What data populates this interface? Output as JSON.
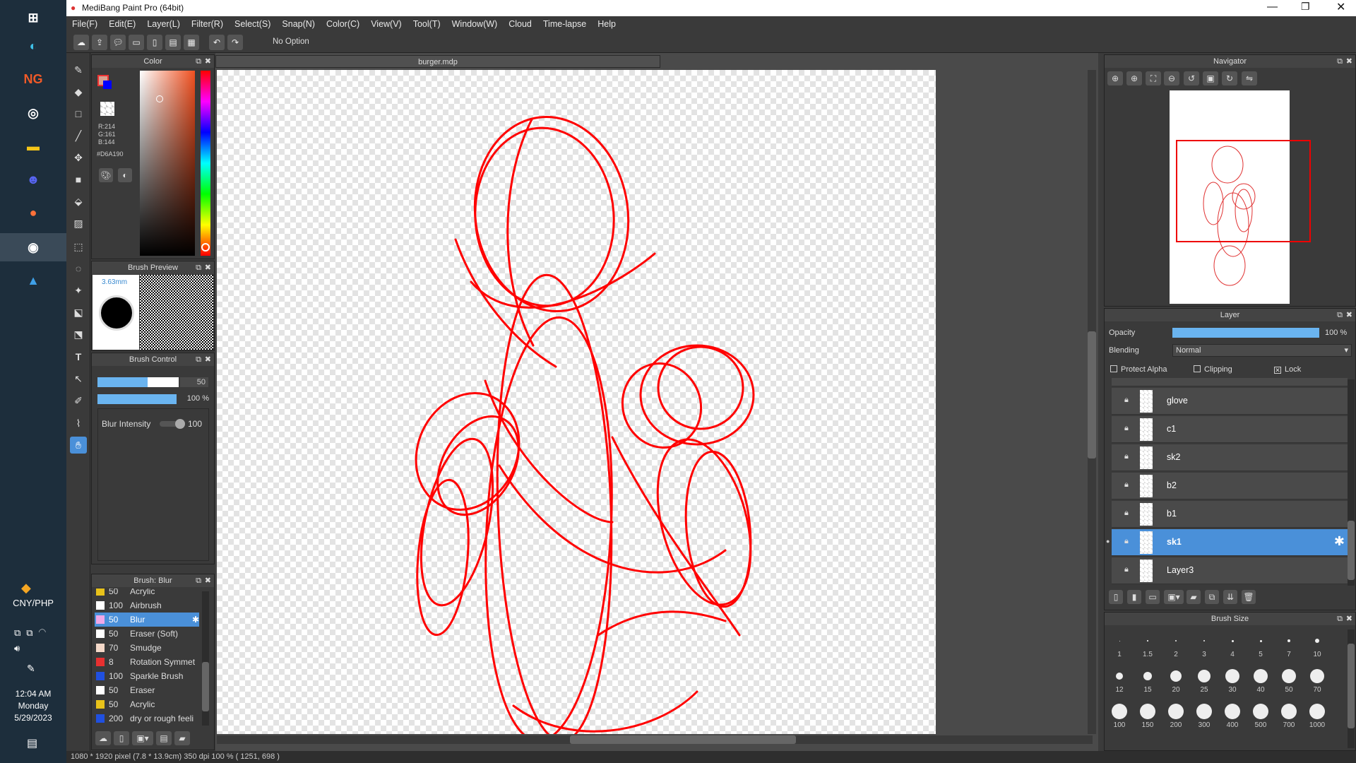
{
  "window": {
    "title": "MediBang Paint Pro (64bit)"
  },
  "menu": [
    "File(F)",
    "Edit(E)",
    "Layer(L)",
    "Filter(R)",
    "Select(S)",
    "Snap(N)",
    "Color(C)",
    "View(V)",
    "Tool(T)",
    "Window(W)",
    "Cloud",
    "Time-lapse",
    "Help"
  ],
  "toolbar": {
    "snap_label": "No Option"
  },
  "document": {
    "tab": "burger.mdp"
  },
  "color_panel": {
    "title": "Color",
    "r": "R:214",
    "g": "G:161",
    "b": "B:144",
    "hex": "#D6A190"
  },
  "brush_preview": {
    "title": "Brush Preview",
    "size": "3.63mm"
  },
  "brush_control": {
    "title": "Brush Control",
    "size_value": "50",
    "opacity_value": "100 %",
    "blur_label": "Blur Intensity",
    "blur_value": "100"
  },
  "brush_list": {
    "title": "Brush: Blur",
    "items": [
      {
        "size": "50",
        "name": "Acrylic",
        "color": "#e8c21a"
      },
      {
        "size": "100",
        "name": "Airbrush",
        "color": "#ffffff"
      },
      {
        "size": "50",
        "name": "Blur",
        "color": "#f0a8e8",
        "selected": true
      },
      {
        "size": "50",
        "name": "Eraser (Soft)",
        "color": "#ffffff"
      },
      {
        "size": "70",
        "name": "Smudge",
        "color": "#f4d8c8"
      },
      {
        "size": "8",
        "name": "Rotation Symmet",
        "color": "#e83030"
      },
      {
        "size": "100",
        "name": "Sparkle Brush",
        "color": "#2050e0"
      },
      {
        "size": "50",
        "name": "Eraser",
        "color": "#ffffff"
      },
      {
        "size": "50",
        "name": "Acrylic",
        "color": "#e8c21a"
      },
      {
        "size": "200",
        "name": "dry or rough feeli",
        "color": "#2050e0"
      }
    ]
  },
  "navigator": {
    "title": "Navigator"
  },
  "layer_panel": {
    "title": "Layer",
    "opacity_label": "Opacity",
    "opacity_value": "100 %",
    "opacity_fraction": 1.0,
    "blending_label": "Blending",
    "blending_value": "Normal",
    "protect_alpha": "Protect Alpha",
    "clipping": "Clipping",
    "lock": "Lock",
    "layers": [
      {
        "name": "glove",
        "selected": false
      },
      {
        "name": "c1",
        "selected": false
      },
      {
        "name": "sk2",
        "selected": false
      },
      {
        "name": "b2",
        "selected": false
      },
      {
        "name": "b1",
        "selected": false
      },
      {
        "name": "sk1",
        "selected": true
      },
      {
        "name": "Layer3",
        "selected": false
      }
    ]
  },
  "brush_size": {
    "title": "Brush Size",
    "sizes": [
      "1",
      "1.5",
      "2",
      "3",
      "4",
      "5",
      "7",
      "10",
      "12",
      "15",
      "20",
      "25",
      "30",
      "40",
      "50",
      "70",
      "100",
      "150",
      "200",
      "300",
      "400",
      "500",
      "700",
      "1000"
    ]
  },
  "status": "1080 * 1920 pixel   (7.8 * 13.9cm)   350 dpi   100 %   ( 1251, 698 )",
  "taskbar": {
    "currency": "CNY/PHP",
    "time": "12:04 AM",
    "day": "Monday",
    "date": "5/29/2023"
  }
}
